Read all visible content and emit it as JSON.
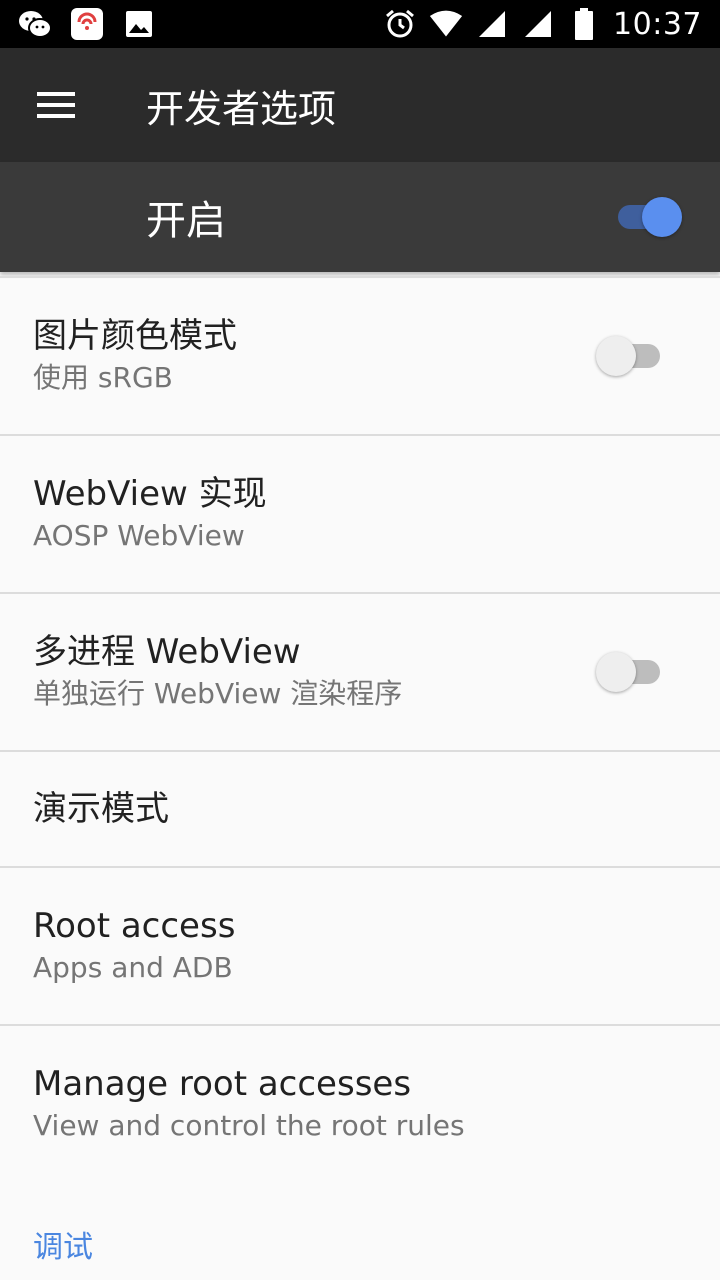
{
  "status_bar": {
    "time": "10:37",
    "icons": [
      "wechat-icon",
      "app-icon",
      "image-icon",
      "alarm-icon",
      "wifi-icon",
      "signal-icon",
      "signal-icon-2",
      "battery-icon"
    ]
  },
  "app_bar": {
    "title": "开发者选项",
    "menu_icon": "hamburger-menu-icon"
  },
  "master_switch": {
    "label": "开启",
    "checked": true
  },
  "items": [
    {
      "title": "图片颜色模式",
      "summary": "使用 sRGB",
      "has_toggle": true,
      "checked": false
    },
    {
      "title": "WebView 实现",
      "summary": "AOSP WebView",
      "has_toggle": false
    },
    {
      "title": "多进程 WebView",
      "summary": "单独运行 WebView 渲染程序",
      "has_toggle": true,
      "checked": false
    },
    {
      "title": "演示模式",
      "summary": "",
      "has_toggle": false
    },
    {
      "title": "Root access",
      "summary": "Apps and ADB",
      "has_toggle": false
    },
    {
      "title": "Manage root accesses",
      "summary": "View and control the root rules",
      "has_toggle": false
    }
  ],
  "section": {
    "label": "调试"
  },
  "colors": {
    "accent": "#5a8fef",
    "toolbar": "#2b2b2b",
    "master_bar": "#3a3a3a",
    "section_header": "#4a86e0"
  }
}
